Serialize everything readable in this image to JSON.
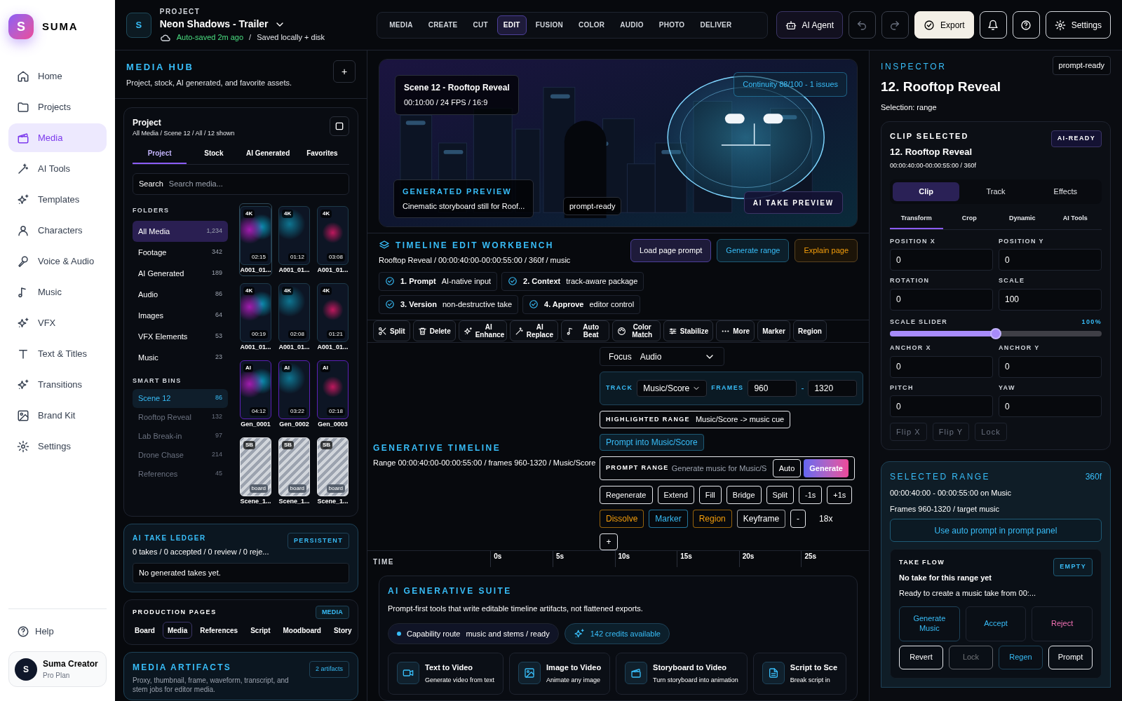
{
  "brand": {
    "logo_letter": "S",
    "name": "SUMA"
  },
  "nav": [
    {
      "label": "Home",
      "selected": false
    },
    {
      "label": "Projects",
      "selected": false
    },
    {
      "label": "Media",
      "selected": true
    },
    {
      "label": "AI Tools",
      "selected": false
    },
    {
      "label": "Templates",
      "selected": false
    },
    {
      "label": "Characters",
      "selected": false
    },
    {
      "label": "Voice & Audio",
      "selected": false
    },
    {
      "label": "Music",
      "selected": false
    },
    {
      "label": "VFX",
      "selected": false
    },
    {
      "label": "Text & Titles",
      "selected": false
    },
    {
      "label": "Transitions",
      "selected": false
    },
    {
      "label": "Brand Kit",
      "selected": false
    },
    {
      "label": "Settings",
      "selected": false
    }
  ],
  "help": "Help",
  "user": {
    "avatar_letter": "S",
    "name": "Suma Creator",
    "plan": "Pro Plan"
  },
  "header": {
    "project_letter": "S",
    "eyebrow": "PROJECT",
    "title": "Neon Shadows - Trailer",
    "autosave": "Auto-saved 2m ago",
    "separator": "/",
    "saved": "Saved locally + disk",
    "pages": [
      {
        "label": "MEDIA",
        "selected": false
      },
      {
        "label": "CREATE",
        "selected": false
      },
      {
        "label": "CUT",
        "selected": false
      },
      {
        "label": "EDIT",
        "selected": true
      },
      {
        "label": "FUSION",
        "selected": false
      },
      {
        "label": "COLOR",
        "selected": false
      },
      {
        "label": "AUDIO",
        "selected": false
      },
      {
        "label": "PHOTO",
        "selected": false
      },
      {
        "label": "DELIVER",
        "selected": false
      }
    ],
    "ai_agent": "AI Agent",
    "export": "Export",
    "settings": "Settings"
  },
  "media_hub": {
    "title": "MEDIA HUB",
    "subtitle": "Project, stock, AI generated, and favorite assets.",
    "add": "+",
    "browser": {
      "title": "Project",
      "path": "All Media / Scene 12 / All / 12 shown",
      "tabs": [
        {
          "label": "Project",
          "selected": true
        },
        {
          "label": "Stock",
          "selected": false
        },
        {
          "label": "AI Generated",
          "selected": false
        },
        {
          "label": "Favorites",
          "selected": false
        }
      ],
      "search": {
        "label": "Search",
        "placeholder": "Search media..."
      },
      "folders_title": "FOLDERS",
      "folders": [
        {
          "label": "All Media",
          "count": "1,234",
          "selected": true
        },
        {
          "label": "Footage",
          "count": "342",
          "selected": false
        },
        {
          "label": "AI Generated",
          "count": "189",
          "selected": false
        },
        {
          "label": "Audio",
          "count": "86",
          "selected": false
        },
        {
          "label": "Images",
          "count": "64",
          "selected": false
        },
        {
          "label": "VFX Elements",
          "count": "53",
          "selected": false
        },
        {
          "label": "Music",
          "count": "23",
          "selected": false
        }
      ],
      "bins_title": "SMART BINS",
      "bins": [
        {
          "label": "Scene 12",
          "count": "86",
          "selected": true
        },
        {
          "label": "Rooftop Reveal",
          "count": "132",
          "selected": false
        },
        {
          "label": "Lab Break-in",
          "count": "97",
          "selected": false
        },
        {
          "label": "Drone Chase",
          "count": "214",
          "selected": false
        },
        {
          "label": "References",
          "count": "45",
          "selected": false
        }
      ],
      "assets": [
        {
          "kind": "clip",
          "badge": "4K",
          "duration": "02:15",
          "name": "A001_01...",
          "selected": true
        },
        {
          "kind": "clip",
          "badge": "4K",
          "duration": "01:12",
          "name": "A001_01...",
          "selected": false
        },
        {
          "kind": "clip",
          "badge": "4K",
          "duration": "03:08",
          "name": "A001_01...",
          "selected": false
        },
        {
          "kind": "clip",
          "badge": "4K",
          "duration": "00:19",
          "name": "A001_01...",
          "selected": false
        },
        {
          "kind": "clip",
          "badge": "4K",
          "duration": "02:08",
          "name": "A001_01...",
          "selected": false
        },
        {
          "kind": "clip",
          "badge": "4K",
          "duration": "01:21",
          "name": "A001_01...",
          "selected": false
        },
        {
          "kind": "ai",
          "badge": "AI",
          "duration": "04:12",
          "name": "Gen_0001",
          "selected": false
        },
        {
          "kind": "ai",
          "badge": "AI",
          "duration": "03:22",
          "name": "Gen_0002",
          "selected": false
        },
        {
          "kind": "ai",
          "badge": "AI",
          "duration": "02:18",
          "name": "Gen_0003",
          "selected": false
        },
        {
          "kind": "storyboard",
          "badge": "SB",
          "duration": "board",
          "name": "Scene_1...",
          "selected": false
        },
        {
          "kind": "storyboard",
          "badge": "SB",
          "duration": "board",
          "name": "Scene_1...",
          "selected": false
        },
        {
          "kind": "storyboard",
          "badge": "SB",
          "duration": "board",
          "name": "Scene_1...",
          "selected": false
        }
      ]
    },
    "ledger": {
      "title": "AI TAKE LEDGER",
      "badge": "PERSISTENT",
      "summary": "0 takes / 0 accepted / 0 review / 0 reje...",
      "empty": "No generated takes yet."
    },
    "production_pages": {
      "title": "PRODUCTION PAGES",
      "badge": "MEDIA",
      "tabs": [
        {
          "label": "Board",
          "selected": false
        },
        {
          "label": "Media",
          "selected": true
        },
        {
          "label": "References",
          "selected": false
        },
        {
          "label": "Script",
          "selected": false
        },
        {
          "label": "Moodboard",
          "selected": false
        },
        {
          "label": "Story",
          "selected": false
        }
      ]
    },
    "artifacts": {
      "title": "MEDIA ARTIFACTS",
      "badge": "2 artifacts",
      "description": "Proxy, thumbnail, frame, waveform, transcript, and stem jobs for editor media."
    }
  },
  "preview": {
    "scene": "Scene 12 - Rooftop Reveal",
    "meta": "00:10:00 / 24 FPS / 16:9",
    "continuity": "Continuity 88/100 - 1 issues",
    "card_title": "GENERATED PREVIEW",
    "card_text": "Cinematic storyboard still for Roof...",
    "status": "prompt-ready",
    "take_button": "AI TAKE PREVIEW"
  },
  "workbench": {
    "title": "TIMELINE EDIT WORKBENCH",
    "subtitle": "Rooftop Reveal / 00:00:40:00-00:00:55:00 / 360f / music",
    "buttons": [
      {
        "kind": "primary",
        "label": "Load page prompt"
      },
      {
        "kind": "accent",
        "label": "Generate range"
      },
      {
        "kind": "warning",
        "label": "Explain page"
      }
    ],
    "steps": [
      {
        "label": "1. Prompt",
        "detail": "AI-native input"
      },
      {
        "label": "2. Context",
        "detail": "track-aware package"
      },
      {
        "label": "3. Version",
        "detail": "non-destructive take"
      },
      {
        "label": "4. Approve",
        "detail": "editor control"
      }
    ]
  },
  "toolbar": [
    {
      "label": "Split"
    },
    {
      "label": "Delete"
    },
    {
      "label": "AI Enhance"
    },
    {
      "label": "AI Replace"
    },
    {
      "label": "Auto Beat"
    },
    {
      "label": "Color Match"
    },
    {
      "label": "Stabilize"
    },
    {
      "label": "More"
    },
    {
      "label": "Marker"
    },
    {
      "label": "Region"
    }
  ],
  "timeline": {
    "title": "GENERATIVE TIMELINE",
    "range": "Range 00:00:40:00-00:00:55:00 / frames 960-1320 / Music/Score",
    "focus": {
      "label": "Focus",
      "value": "Audio"
    },
    "track": {
      "label": "TRACK",
      "value": "Music/Score",
      "frames_label": "FRAMES",
      "start": "960",
      "dash": "-",
      "end": "1320"
    },
    "highlight": {
      "label": "HIGHLIGHTED RANGE",
      "value": "Music/Score -> music cue"
    },
    "prompt_into": "Prompt into Music/Score",
    "prompt": {
      "label": "PROMPT RANGE",
      "placeholder": "Generate music for Music/S",
      "auto": "Auto",
      "generate": "Generate"
    },
    "actions": [
      {
        "label": "Regenerate"
      },
      {
        "label": "Extend"
      },
      {
        "label": "Fill"
      },
      {
        "label": "Bridge"
      },
      {
        "label": "Split"
      },
      {
        "label": "-1s"
      },
      {
        "label": "+1s"
      }
    ],
    "transitions": [
      {
        "label": "Dissolve",
        "color": "#f59e0b"
      },
      {
        "label": "Marker",
        "color": "#38bdf8"
      },
      {
        "label": "Region",
        "color": "#f59e0b"
      },
      {
        "label": "Keyframe",
        "color": "#ffffff"
      }
    ],
    "zoom": {
      "minus": "-",
      "value": "18x",
      "plus": "+"
    },
    "ruler": {
      "label": "TIME",
      "ticks": [
        "0s",
        "5s",
        "10s",
        "15s",
        "20s",
        "25s"
      ]
    }
  },
  "suite": {
    "title": "AI GENERATIVE SUITE",
    "subtitle": "Prompt-first tools that write editable timeline artifacts, not flattened exports.",
    "route": {
      "label": "Capability route",
      "value": "music and stems / ready"
    },
    "credits": "142 credits available",
    "tools": [
      {
        "title": "Text to Video",
        "description": "Generate video from text"
      },
      {
        "title": "Image to Video",
        "description": "Animate any image"
      },
      {
        "title": "Storyboard to Video",
        "description": "Turn storyboard into animation"
      },
      {
        "title": "Script to Sce",
        "description": "Break script in"
      }
    ]
  },
  "inspector": {
    "title": "INSPECTOR",
    "status": "prompt-ready",
    "name": "12. Rooftop Reveal",
    "selection": "Selection: range",
    "clip": {
      "title": "CLIP SELECTED",
      "badge": "AI-READY",
      "name": "12. Rooftop Reveal",
      "timecode": "00:00:40:00-00:00:55:00 / 360f",
      "segments": [
        {
          "label": "Clip",
          "selected": true
        },
        {
          "label": "Track",
          "selected": false
        },
        {
          "label": "Effects",
          "selected": false
        }
      ],
      "tabs": [
        {
          "label": "Transform",
          "selected": true
        },
        {
          "label": "Crop",
          "selected": false
        },
        {
          "label": "Dynamic",
          "selected": false
        },
        {
          "label": "AI Tools",
          "selected": false
        }
      ],
      "fields_top": [
        {
          "label": "POSITION X",
          "value": "0"
        },
        {
          "label": "POSITION Y",
          "value": "0"
        },
        {
          "label": "ROTATION",
          "value": "0"
        },
        {
          "label": "SCALE",
          "value": "100"
        }
      ],
      "slider": {
        "label": "SCALE SLIDER",
        "reading": "100%",
        "level": 0.5
      },
      "fields_bottom": [
        {
          "label": "ANCHOR X",
          "value": "0"
        },
        {
          "label": "ANCHOR Y",
          "value": "0"
        },
        {
          "label": "PITCH",
          "value": "0"
        },
        {
          "label": "YAW",
          "value": "0"
        }
      ],
      "buttons": [
        {
          "label": "Flip X",
          "disabled": true
        },
        {
          "label": "Flip Y",
          "disabled": true
        },
        {
          "label": "Lock",
          "disabled": true
        }
      ]
    },
    "range": {
      "title": "SELECTED RANGE",
      "frames": "360f",
      "line1": "00:00:40:00 - 00:00:55:00 on Music",
      "line2": "Frames 960-1320 / target music",
      "button": "Use auto prompt in prompt panel",
      "take": {
        "title": "TAKE FLOW",
        "badge": "EMPTY",
        "headline": "No take for this range yet",
        "text": "Ready to create a music take from 00:...",
        "buttons": [
          {
            "label": "Generate Music",
            "kind": "accent",
            "disabled": false
          },
          {
            "label": "Accept",
            "kind": "positive",
            "disabled": false
          },
          {
            "label": "Reject",
            "kind": "danger",
            "disabled": false
          }
        ],
        "buttons_small": [
          {
            "label": "Revert",
            "kind": "outline",
            "disabled": false
          },
          {
            "label": "Lock",
            "kind": "outline",
            "disabled": true
          },
          {
            "label": "Regen",
            "kind": "accent",
            "disabled": false
          },
          {
            "label": "Prompt",
            "kind": "outline",
            "disabled": false
          }
        ]
      }
    }
  }
}
